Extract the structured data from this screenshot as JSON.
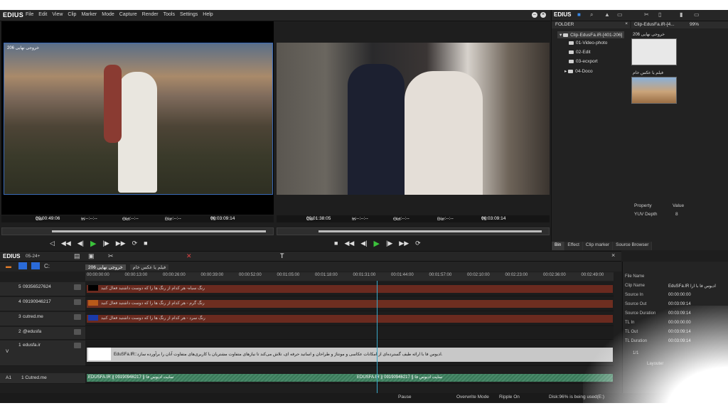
{
  "app": {
    "logo": "EDIUS",
    "menu": [
      "File",
      "Edit",
      "View",
      "Clip",
      "Marker",
      "Mode",
      "Capture",
      "Render",
      "Tools",
      "Settings",
      "Help"
    ]
  },
  "player": {
    "left_label": "خروجی نهایی 206",
    "left_tc": {
      "cur_label": "Cur",
      "cur": "00:00:49:06",
      "in_label": "In",
      "in": "--:--:--:--",
      "out_label": "Out",
      "out": "--:--:--:--",
      "dur_label": "Dur",
      "dur": "--:--:--:--",
      "ttl_label": "Ttl",
      "ttl": "00:03:09:14"
    },
    "right_tc": {
      "cur_label": "Cur",
      "cur": "00:01:38:05",
      "in_label": "In",
      "in": "--:--:--:--",
      "out_label": "Out",
      "out": "--:--:--:--",
      "dur_label": "Dur",
      "dur": "--:--:--:--",
      "ttl_label": "Ttl",
      "ttl": "00:03:09:14"
    },
    "controls_left": [
      "◁",
      "◀◀",
      "◀|",
      "▶",
      "|▶",
      "▶▶",
      "⟳",
      "■"
    ],
    "controls_right": [
      "■",
      "◀◀",
      "◀|",
      "▶",
      "|▶",
      "▶▶",
      "⟳"
    ]
  },
  "bin": {
    "tools_logo": "EDIUS",
    "folder_header": "FOLDER",
    "clip_header": "Clip-EdusFa.iR-[4...",
    "zoom": "99%",
    "tree": [
      "Clip-EdusFa.iR-[401-206]",
      "01-Video-photo",
      "02-Edit",
      "03-ecxport",
      "04-Doco"
    ],
    "thumbs": [
      "خروجی نهایی 206",
      "فیلم یا عکس خام"
    ],
    "prop_header": "Property",
    "val_header": "Value",
    "prop_name": "YUV Depth",
    "prop_val": "8",
    "tabs": [
      "Bin",
      "Effect",
      "Clip marker",
      "Source Browser"
    ]
  },
  "timeline": {
    "logo": "EDIUS",
    "project": "05-24+",
    "tabs": [
      "خروجی نهایی 206",
      "فیلم یا عکس خام"
    ],
    "ruler": [
      "00:00:00:00",
      "00:00:13:00",
      "00:00:26:00",
      "00:00:39:00",
      "00:00:52:00",
      "00:01:05:00",
      "00:01:18:00",
      "00:01:31:00",
      "00:01:44:00",
      "00:01:57:00",
      "00:02:10:00",
      "00:02:23:00",
      "00:02:36:00",
      "00:02:49:00"
    ],
    "tracks": [
      {
        "id": "5",
        "name": "09356527624",
        "clip": "رنگ سیاه- هر کدام از رنگ ها را که دوست داشتید فعال کنید",
        "color": "#6a2a1f",
        "swatch": "#000000"
      },
      {
        "id": "4",
        "name": "09190946217",
        "clip": "رنگ گرم - هر کدام از رنگ ها را که دوست داشتید فعال کنید",
        "color": "#6e2e20",
        "swatch": "#b85a1a"
      },
      {
        "id": "3",
        "name": "cutred.me",
        "clip": "رنگ سرد - هر کدام از رنگ ها را که دوست داشتید فعال کنید",
        "color": "#6a2a1f",
        "swatch": "#1a3aa8"
      },
      {
        "id": "2",
        "name": "@edusfa",
        "clip": "",
        "color": "",
        "swatch": ""
      },
      {
        "id": "1",
        "name": "edusfa.ir",
        "clip": "EduSFa.IR::ادیوس فا با ارائه طیف گسترده‌ای از امکانات عکاسی و مونتاژ و طراحان و اساتید حرفه ای، تلاش می‌کند تا نیازهای متفاوت مشتریان با کاربری‌های متفاوت آنان را برآورده سازد.",
        "color": "#7a7a7a",
        "swatch": "#ffffff"
      }
    ],
    "track_v": "V",
    "track_a1": "A1",
    "audio_name": "1 Cutred.me",
    "audio_clip1": "EDUSFA.IR || 09190946217 || سایت ادیوس فا",
    "audio_clip2": "EDUSFA.IR || 09190946217 || سایت ادیوس فا"
  },
  "info": {
    "rows": [
      {
        "k": "File Name",
        "v": ""
      },
      {
        "k": "Clip Name",
        "v": "EduSFa.IR ادیوس فا با ارا"
      },
      {
        "k": "Source In",
        "v": "00:00:00:00"
      },
      {
        "k": "Source Out",
        "v": "00:03:09:14"
      },
      {
        "k": "Source Duration",
        "v": "00:03:09:14"
      },
      {
        "k": "TL In",
        "v": "00:00:00:00"
      },
      {
        "k": "TL Out",
        "v": "00:03:09:14"
      },
      {
        "k": "TL Duration",
        "v": "00:03:09:14"
      }
    ],
    "page": "1/1",
    "effect": "Layouter"
  },
  "status": {
    "pause": "Pause",
    "overwrite": "Overwrite Mode",
    "ripple": "Ripple On",
    "disk": "Disk:96% is being used(E:)"
  }
}
